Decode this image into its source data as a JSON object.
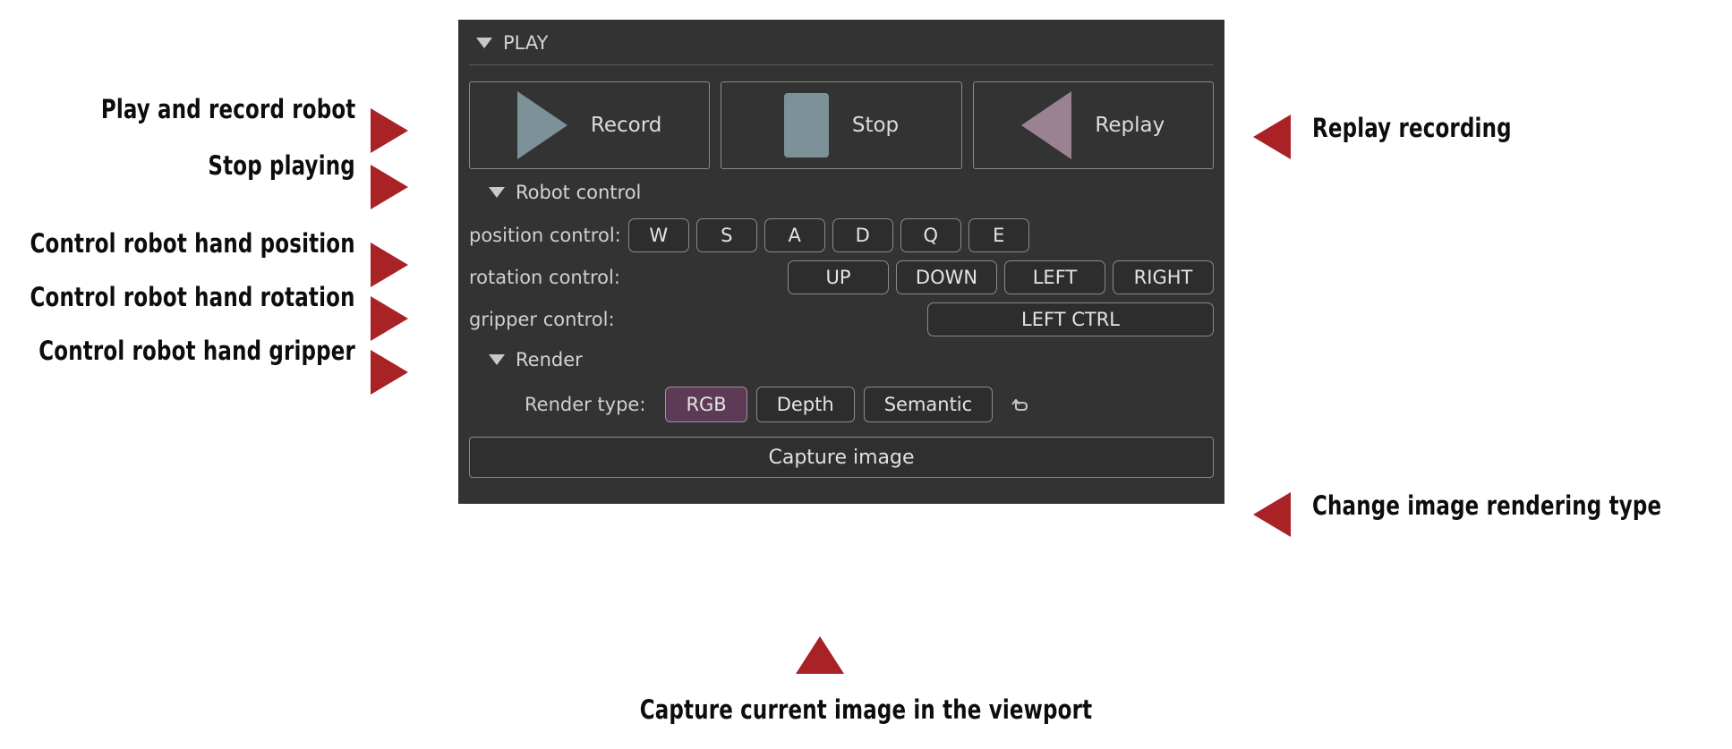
{
  "panel": {
    "play_section": {
      "title": "PLAY",
      "buttons": [
        {
          "label": "Record",
          "icon": "play-triangle-icon",
          "color": "#7d9199"
        },
        {
          "label": "Stop",
          "icon": "stop-square-icon",
          "color": "#7d9199"
        },
        {
          "label": "Replay",
          "icon": "rewind-triangle-icon",
          "color": "#9b8292"
        }
      ]
    },
    "robot_control_section": {
      "title": "Robot control",
      "position_control": {
        "label": "position control:",
        "keys": [
          "W",
          "S",
          "A",
          "D",
          "Q",
          "E"
        ]
      },
      "rotation_control": {
        "label": "rotation control:",
        "keys": [
          "UP",
          "DOWN",
          "LEFT",
          "RIGHT"
        ]
      },
      "gripper_control": {
        "label": "gripper control:",
        "keys": [
          "LEFT CTRL"
        ]
      }
    },
    "render_section": {
      "title": "Render",
      "render_type_label": "Render type:",
      "options": [
        "RGB",
        "Depth",
        "Semantic"
      ],
      "selected": "RGB",
      "selected_color": "#5d3a56",
      "reset_icon": "undo-arrow-icon",
      "capture_button": "Capture image"
    }
  },
  "annotations": {
    "arrow_color": "#a82226",
    "left": [
      {
        "text": "Play and record robot",
        "arrow": "arrow-right-icon"
      },
      {
        "text": "Stop playing",
        "arrow": "arrow-right-icon"
      },
      {
        "text": "Control robot hand position",
        "arrow": "arrow-right-icon"
      },
      {
        "text": "Control robot hand rotation",
        "arrow": "arrow-right-icon"
      },
      {
        "text": "Control robot hand gripper",
        "arrow": "arrow-right-icon"
      }
    ],
    "right": [
      {
        "text": "Replay recording",
        "arrow": "arrow-left-icon"
      },
      {
        "text": "Change image rendering type",
        "arrow": "arrow-left-icon"
      }
    ],
    "bottom": [
      {
        "text": "Capture current image in the viewport",
        "arrow": "arrow-up-icon"
      }
    ]
  }
}
